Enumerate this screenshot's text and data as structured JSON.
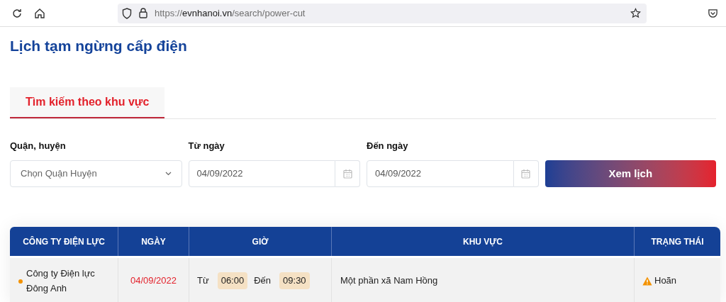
{
  "browser": {
    "url": {
      "scheme": "https://",
      "domain": "evnhanoi.vn",
      "path": "/search/power-cut"
    }
  },
  "page_title": "Lịch tạm ngừng cấp điện",
  "tabs": [
    {
      "label": "Tìm kiếm theo khu vực",
      "selected": true
    }
  ],
  "filters": [
    {
      "kind": "select",
      "label": "Quận, huyện",
      "placeholder": "Chọn Quận Huyện"
    },
    {
      "kind": "date",
      "label": "Từ ngày",
      "value": "04/09/2022"
    },
    {
      "kind": "date",
      "label": "Đến ngày",
      "value": "04/09/2022"
    }
  ],
  "search_button": "Xem lịch",
  "table": {
    "columns": [
      "CÔNG TY ĐIỆN LỰC",
      "NGÀY",
      "GIỜ",
      "KHU VỰC",
      "TRẠNG THÁI"
    ],
    "rows": [
      {
        "company": "Công ty Điện lực Đông Anh",
        "color": "#f39200",
        "date": "04/09/2022",
        "from_label": "Từ",
        "from": "06:00",
        "to_label": "Đến",
        "to": "09:30",
        "area": "Một phần xã Nam Hồng",
        "status": {
          "kind": "warning",
          "label": "Hoãn"
        }
      }
    ]
  }
}
